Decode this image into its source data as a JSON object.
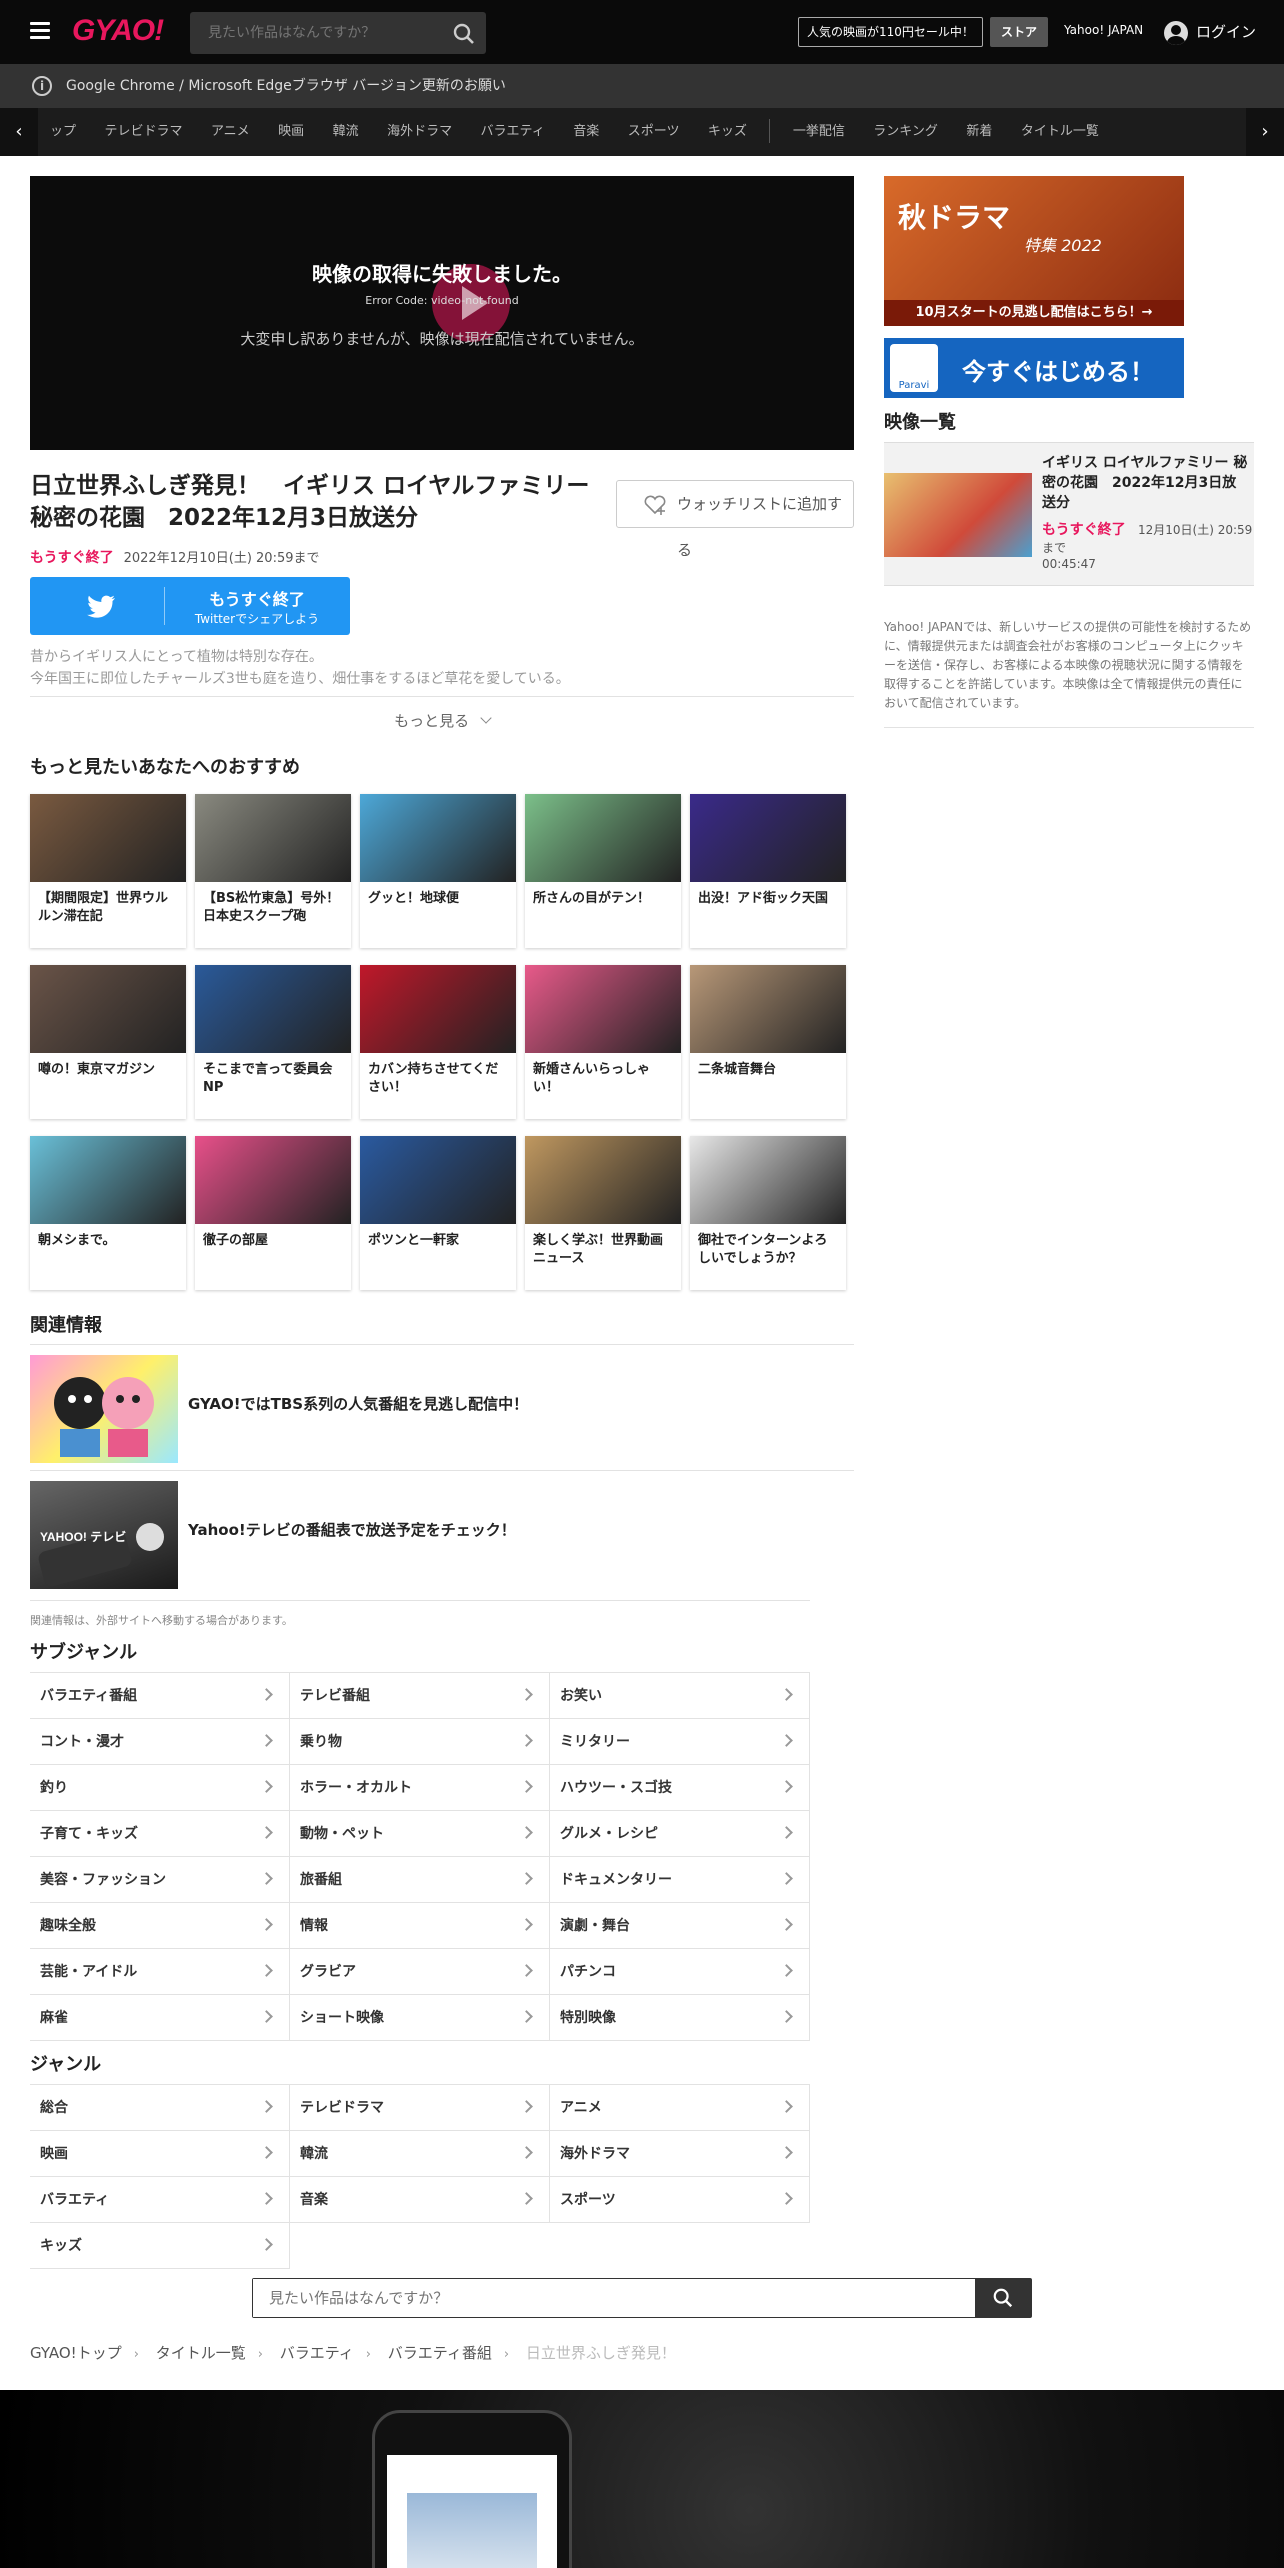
{
  "header": {
    "logo": "GYAO!",
    "search_placeholder": "見たい作品はなんですか？",
    "promo": "人気の映画が110円セール中！",
    "store": "ストア",
    "yahoo_japan": "Yahoo! JAPAN",
    "login": "ログイン"
  },
  "notice": "Google Chrome / Microsoft Edgeブラウザ バージョン更新のお願い",
  "nav": {
    "items": [
      "ップ",
      "テレビドラマ",
      "アニメ",
      "映画",
      "韓流",
      "海外ドラマ",
      "バラエティ",
      "音楽",
      "スポーツ",
      "キッズ"
    ],
    "items2": [
      "一挙配信",
      "ランキング",
      "新着",
      "タイトル一覧"
    ]
  },
  "player": {
    "error_title": "映像の取得に失敗しました。",
    "error_code": "Error Code: video-not-found",
    "error_msg": "大変申し訳ありませんが、映像は現在配信されていません。"
  },
  "video": {
    "title": "日立世界ふしぎ発見！　イギリス ロイヤルファミリー 秘密の花園　2022年12月3日放送分",
    "watchlist": "ウォッチリストに追加する",
    "ending_soon": "もうすぐ終了",
    "end_date": "2022年12月10日(土) 20:59まで",
    "twitter_main": "もうすぐ終了",
    "twitter_sub": "Twitterでシェアしよう",
    "desc_line1": "昔からイギリス人にとって植物は特別な存在。",
    "desc_line2": "今年国王に即位したチャールズ3世も庭を造り、畑仕事をするほど草花を愛している。",
    "more": "もっと見る"
  },
  "recommend": {
    "title": "もっと見たいあなたへのおすすめ",
    "items": [
      "【期間限定】世界ウルルン滞在記",
      "【BS松竹東急】号外！日本史スクープ砲",
      "グッと！地球便",
      "所さんの目がテン！",
      "出没！アド街ック天国",
      "噂の！東京マガジン",
      "そこまで言って委員会NP",
      "カバン持ちさせてください！",
      "新婚さんいらっしゃい！",
      "二条城音舞台",
      "朝メシまで。",
      "徹子の部屋",
      "ポツンと一軒家",
      "楽しく学ぶ！世界動画ニュース",
      "御社でインターンよろしいでしょうか？"
    ],
    "colors": [
      "#7a5a40",
      "#8a8a80",
      "#4da8d8",
      "#7cc08a",
      "#3a2a8a",
      "#6a5448",
      "#2a5a9a",
      "#c0182a",
      "#e85a8a",
      "#b89878",
      "#6ac0d8",
      "#e8508a",
      "#2a5aa0",
      "#c09860",
      "#e8e8e8"
    ]
  },
  "related": {
    "title": "関連情報",
    "items": [
      "GYAO!ではTBS系列の人気番組を見逃し配信中！",
      "Yahoo!テレビの番組表で放送予定をチェック！"
    ],
    "note": "関連情報は、外部サイトへ移動する場合があります。"
  },
  "subgenre": {
    "title": "サブジャンル",
    "items": [
      "バラエティ番組",
      "テレビ番組",
      "お笑い",
      "コント・漫才",
      "乗り物",
      "ミリタリー",
      "釣り",
      "ホラー・オカルト",
      "ハウツー・スゴ技",
      "子育て・キッズ",
      "動物・ペット",
      "グルメ・レシピ",
      "美容・ファッション",
      "旅番組",
      "ドキュメンタリー",
      "趣味全般",
      "情報",
      "演劇・舞台",
      "芸能・アイドル",
      "グラビア",
      "パチンコ",
      "麻雀",
      "ショート映像",
      "特別映像"
    ]
  },
  "genre": {
    "title": "ジャンル",
    "items": [
      "総合",
      "テレビドラマ",
      "アニメ",
      "映画",
      "韓流",
      "海外ドラマ",
      "バラエティ",
      "音楽",
      "スポーツ",
      "キッズ"
    ]
  },
  "bottom_search_placeholder": "見たい作品はなんですか？",
  "breadcrumb": [
    "GYAO!トップ",
    "タイトル一覧",
    "バラエティ",
    "バラエティ番組",
    "日立世界ふしぎ発見！"
  ],
  "sidebar": {
    "ad1_text": "秋ドラマ",
    "ad1_sub": "特集 2022",
    "ad1_cta": "10月スタートの見逃し配信はこちら！→",
    "ad2_logo": "Paravi",
    "ad2_text": "今すぐはじめる！",
    "list_title": "映像一覧",
    "item_title": "イギリス ロイヤルファミリー 秘密の花園　2022年12月3日放送分",
    "item_soon": "もうすぐ終了",
    "item_end": "12月10日(土) 20:59",
    "item_made": "まで",
    "item_duration": "00:45:47",
    "disclaimer": "Yahoo! JAPANでは、新しいサービスの提供の可能性を検討するために、情報提供元または調査会社がお客様のコンピュータ上にクッキーを送信・保存し、お客様による本映像の視聴状況に関する情報を取得することを許諾しています。本映像は全て情報提供元の責任において配信されています。"
  }
}
